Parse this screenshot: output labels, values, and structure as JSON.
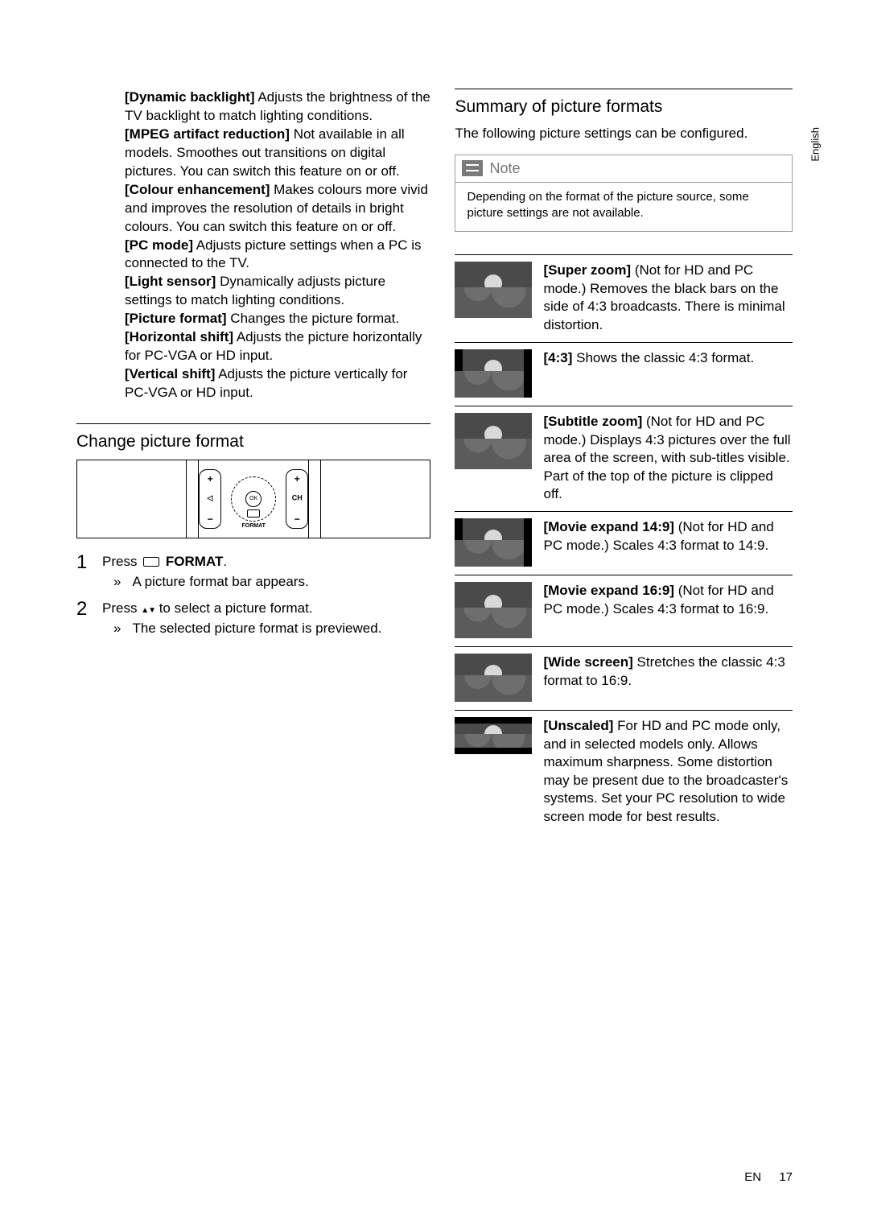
{
  "language_tab": "English",
  "left": {
    "settings": [
      {
        "label": "[Dynamic backlight]",
        "desc": " Adjusts the brightness of the TV backlight to match lighting conditions."
      },
      {
        "label": "[MPEG artifact reduction]",
        "desc": " Not available in all models. Smoothes out transitions on digital pictures. You can switch this feature on or off."
      },
      {
        "label": "[Colour enhancement]",
        "desc": " Makes colours more vivid and improves the resolution of details in bright colours. You can switch this feature on or off."
      },
      {
        "label": "[PC mode]",
        "desc": " Adjusts picture settings when a PC is connected to the TV."
      },
      {
        "label": "[Light sensor]",
        "desc": " Dynamically adjusts picture settings to match lighting conditions."
      },
      {
        "label": "[Picture format]",
        "desc": " Changes the picture format."
      },
      {
        "label": "[Horizontal shift]",
        "desc": " Adjusts the picture horizontally for PC-VGA or HD input."
      },
      {
        "label": "[Vertical shift]",
        "desc": " Adjusts the picture vertically for PC-VGA or HD input."
      }
    ],
    "change_heading": "Change picture format",
    "remote": {
      "plus": "+",
      "minus": "−",
      "ch": "CH",
      "ok": "OK",
      "format": "FORMAT"
    },
    "steps": [
      {
        "num": "1",
        "prefix": "Press ",
        "action": " FORMAT",
        "suffix": ".",
        "sub": "A picture format bar appears."
      },
      {
        "num": "2",
        "prefix": "Press ",
        "action_suffix": " to select a picture format.",
        "sub": "The selected picture format is previewed."
      }
    ]
  },
  "right": {
    "heading": "Summary of picture formats",
    "intro": "The following picture settings can be conﬁgured.",
    "note_title": "Note",
    "note_body": "Depending on the format of the picture source, some picture settings are not available.",
    "formats": [
      {
        "label": "[Super zoom]",
        "desc": " (Not for HD and PC mode.) Removes the black bars on the side of 4:3 broadcasts. There is minimal distortion.",
        "thumb": "tall"
      },
      {
        "label": "[4:3]",
        "desc": " Shows the classic 4:3 format.",
        "thumb": "pillarbox"
      },
      {
        "label": "[Subtitle zoom]",
        "desc": " (Not for HD and PC mode.) Displays 4:3 pictures over the full area of the screen, with sub-titles visible. Part of the top of the picture is clipped off.",
        "thumb": "tall"
      },
      {
        "label": "[Movie expand 14:9]",
        "desc": " (Not for HD and PC mode.) Scales 4:3 format to 14:9.",
        "thumb": "pillarbox"
      },
      {
        "label": "[Movie expand 16:9]",
        "desc": " (Not for HD and PC mode.) Scales 4:3 format to 16:9.",
        "thumb": "tall"
      },
      {
        "label": "[Wide screen]",
        "desc": " Stretches the classic 4:3 format to 16:9.",
        "thumb": "normal"
      },
      {
        "label": "[Unscaled]",
        "desc": " For HD and PC mode only, and in selected models only. Allows maximum sharpness. Some distortion may be present due to the broadcaster's systems. Set your PC resolution to wide screen mode for best results.",
        "thumb": "short letterbox"
      }
    ]
  },
  "footer": {
    "lang": "EN",
    "page": "17"
  }
}
